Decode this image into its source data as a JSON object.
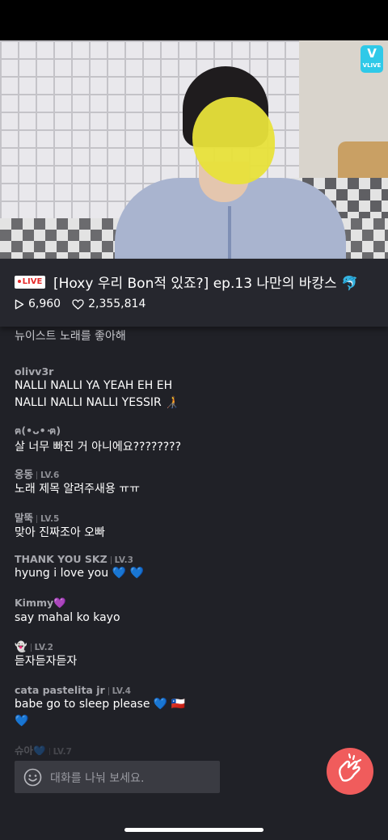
{
  "video": {
    "badge_symbol": "V",
    "badge_text": "VLIVE"
  },
  "stream": {
    "live_label": "LIVE",
    "title": "[Hoxy 우리 Bon적 있죠?] ep.13 나만의 바캉스 🐬",
    "plays": "6,960",
    "likes": "2,355,814"
  },
  "chat": {
    "partial_top_text": "뉴이스트 노래를 좋아해",
    "messages": [
      {
        "nick": "olivv3r",
        "level": "",
        "lines": [
          "NALLI NALLI YA YEAH EH EH",
          "NALLI NALLI NALLI YESSIR 🧑‍🦯"
        ]
      },
      {
        "nick": "ฅ(ٛ•ᴗ•ٛ ฅ)",
        "level": "",
        "lines": [
          "살 너무 빠진 거 아니에요????????"
        ]
      },
      {
        "nick": "옹동",
        "level": "LV.6",
        "lines": [
          "노래 제목 알려주새용 ㅠㅠ"
        ]
      },
      {
        "nick": "말뚝",
        "level": "LV.5",
        "lines": [
          "맞아 진짜조아 오빠"
        ]
      },
      {
        "nick": "THANK YOU SKZ",
        "level": "LV.3",
        "lines": [
          "hyung i love you 💙 💙"
        ]
      },
      {
        "nick": "Kimmy💜",
        "level": "",
        "lines": [
          "say mahal ko kayo"
        ]
      },
      {
        "nick": "👻",
        "level": "LV.2",
        "lines": [
          "듣자듣자듣자"
        ]
      },
      {
        "nick": "cata pastelita jr",
        "level": "LV.4",
        "lines": [
          "babe go to sleep please 💙 🇨🇱",
          "💙"
        ]
      }
    ],
    "partial_bottom_nick": "슈아💙",
    "partial_bottom_level": "LV.7"
  },
  "input": {
    "placeholder": "대화를 나눠 보세요."
  },
  "colors": {
    "live_red": "#e52a2a",
    "heart_button": "#f05c5c",
    "vlive_cyan": "#2fc9e8",
    "background": "#202127"
  },
  "icons": [
    "play-icon",
    "heart-outline-icon",
    "smile-icon",
    "finger-heart-icon",
    "vlive-logo-icon"
  ]
}
